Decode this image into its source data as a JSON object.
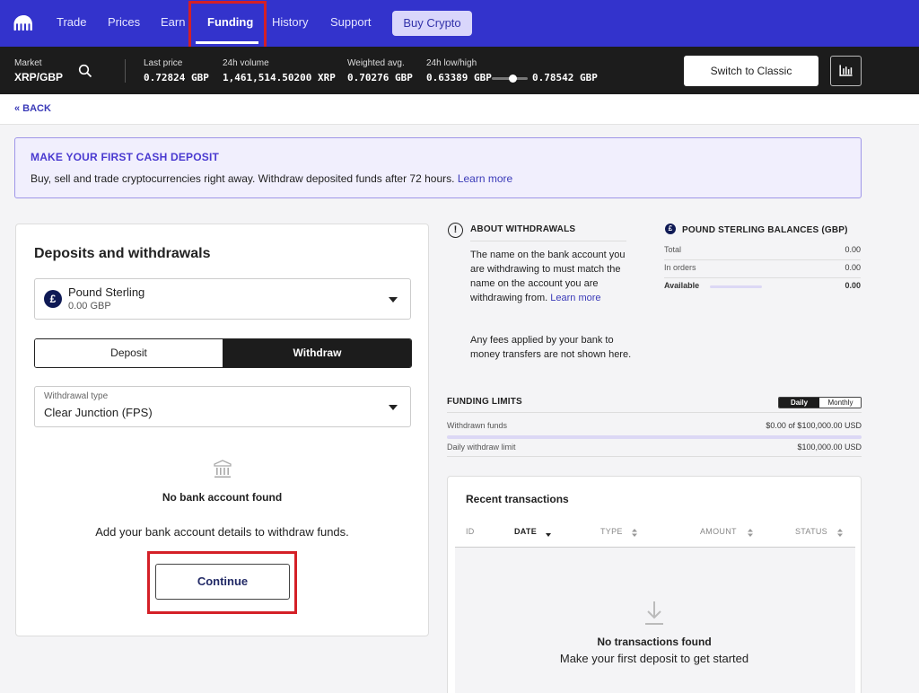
{
  "nav": {
    "items": [
      {
        "label": "Trade"
      },
      {
        "label": "Prices"
      },
      {
        "label": "Earn"
      },
      {
        "label": "Funding"
      },
      {
        "label": "History"
      },
      {
        "label": "Support"
      }
    ],
    "buy_label": "Buy Crypto"
  },
  "ticker": {
    "market_label": "Market",
    "market_value": "XRP/GBP",
    "last_price_label": "Last price",
    "last_price_value": "0.72824 GBP",
    "volume_label": "24h volume",
    "volume_value": "1,461,514.50200 XRP",
    "weighted_label": "Weighted avg.",
    "weighted_value": "0.70276 GBP",
    "lowhigh_label": "24h low/high",
    "low_value": "0.63389 GBP",
    "high_value": "0.78542 GBP",
    "switch_label": "Switch to Classic"
  },
  "back_label": "« BACK",
  "banner": {
    "title": "MAKE YOUR FIRST CASH DEPOSIT",
    "text": "Buy, sell and trade cryptocurrencies right away. Withdraw deposited funds after 72 hours.",
    "link": "Learn more"
  },
  "card": {
    "title": "Deposits and withdrawals",
    "currency_symbol": "£",
    "currency_name": "Pound Sterling",
    "currency_balance": "0.00 GBP",
    "deposit_label": "Deposit",
    "withdraw_label": "Withdraw",
    "withdrawal_type_label": "Withdrawal type",
    "withdrawal_type_value": "Clear Junction (FPS)",
    "no_bank_title": "No bank account found",
    "no_bank_text": "Add your bank account details to withdraw funds.",
    "continue_label": "Continue"
  },
  "about": {
    "title": "ABOUT WITHDRAWALS",
    "p1": "The name on the bank account you are withdrawing to must match the name on the account you are withdrawing from.",
    "p1_link": "Learn more",
    "p2": "Any fees applied by your bank to money transfers are not shown here."
  },
  "balances": {
    "symbol": "£",
    "title": "POUND STERLING BALANCES (GBP)",
    "rows": [
      {
        "label": "Total",
        "value": "0.00"
      },
      {
        "label": "In orders",
        "value": "0.00"
      },
      {
        "label": "Available",
        "value": "0.00"
      }
    ]
  },
  "funding_limits": {
    "title": "FUNDING LIMITS",
    "daily_label": "Daily",
    "monthly_label": "Monthly",
    "withdrawn_label": "Withdrawn funds",
    "withdrawn_value": "$0.00 of $100,000.00 USD",
    "limit_label": "Daily withdraw limit",
    "limit_value": "$100,000.00 USD"
  },
  "transactions": {
    "title": "Recent transactions",
    "columns": [
      "ID",
      "DATE",
      "TYPE",
      "AMOUNT",
      "STATUS"
    ],
    "empty_title": "No transactions found",
    "empty_text": "Make your first deposit to get started"
  }
}
